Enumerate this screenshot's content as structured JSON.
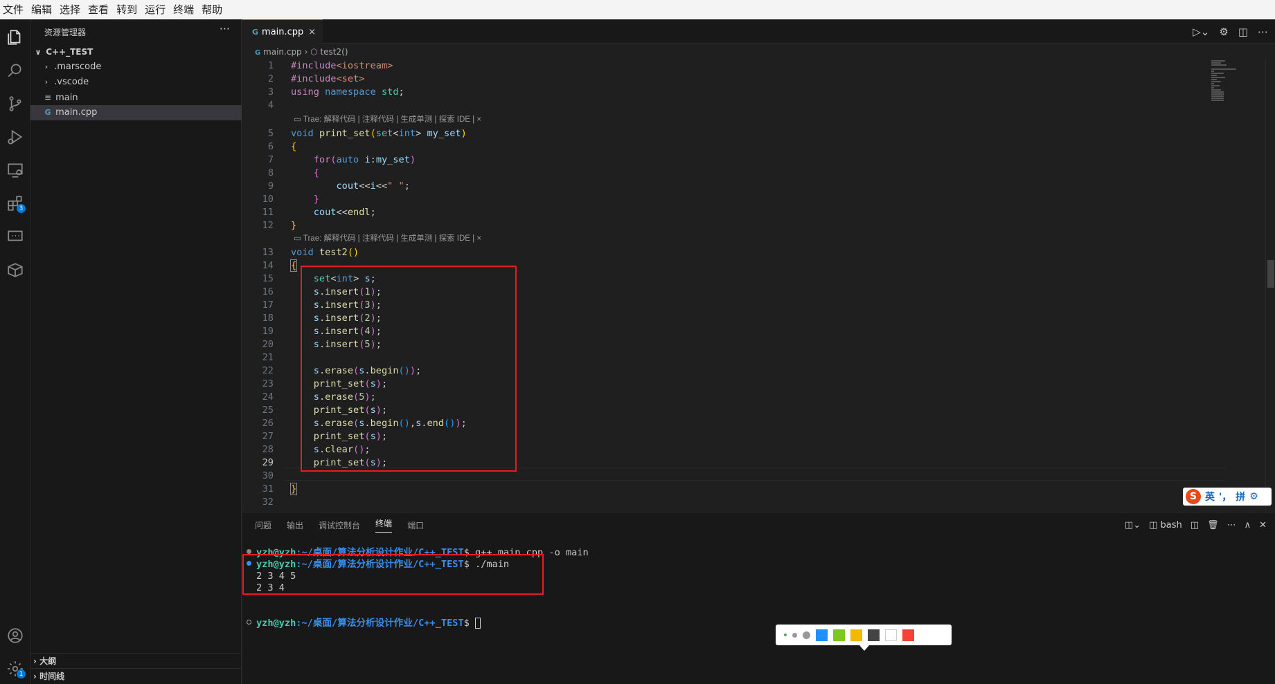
{
  "menu": [
    "文件",
    "编辑",
    "选择",
    "查看",
    "转到",
    "运行",
    "终端",
    "帮助"
  ],
  "activity": {
    "extensions_badge": "3",
    "settings_badge": "1"
  },
  "sidebar": {
    "title": "资源管理器",
    "more": "···",
    "root": "C++_TEST",
    "items": [
      ".marscode",
      ".vscode",
      "main",
      "main.cpp"
    ],
    "outline": "大纲",
    "timeline": "时间线"
  },
  "editor": {
    "tab_label": "main.cpp",
    "tab_close": "×",
    "breadcrumb_file": "main.cpp",
    "breadcrumb_symbol": "test2()",
    "codelens": "Trae: 解释代码 | 注释代码 | 生成单测 | 探索 IDE | ×",
    "current_line": "29"
  },
  "ime": {
    "lang": "英",
    "punct": "'，",
    "mode": "拼"
  },
  "panel": {
    "tabs": [
      "问题",
      "输出",
      "调试控制台",
      "终端",
      "端口"
    ],
    "active_tab": "终端",
    "shell": "bash",
    "lines": [
      {
        "prompt": "yzh@yzh",
        "path": ":~/桌面/算法分析设计作业/C++_TEST",
        "cmd": "$ g++ main.cpp -o main"
      },
      {
        "prompt": "yzh@yzh",
        "path": ":~/桌面/算法分析设计作业/C++_TEST",
        "cmd": "$ ./main"
      },
      {
        "output": "2 3 4 5"
      },
      {
        "output": "2 3 4"
      },
      {
        "prompt": "yzh@yzh",
        "path": ":~/桌面/算法分析设计作业/C++_TEST",
        "cmd": "$ "
      }
    ]
  },
  "palette_colors": [
    "#1e90ff",
    "#7cc81e",
    "#f5b800",
    "#444444",
    "#ffffff",
    "#f44336"
  ]
}
